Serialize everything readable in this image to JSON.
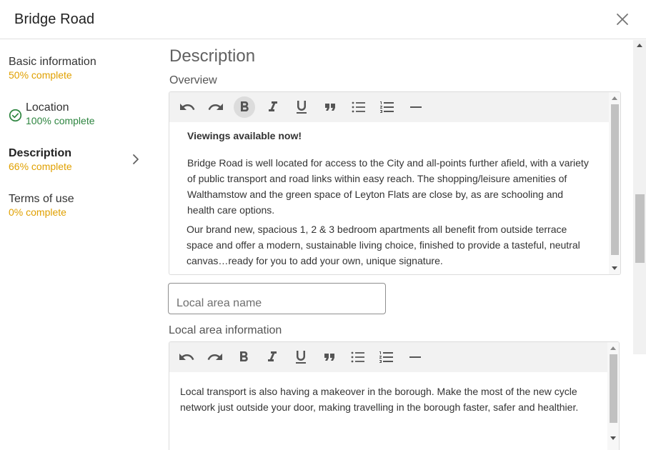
{
  "header": {
    "title": "Bridge Road",
    "close_icon": "close-icon"
  },
  "sidebar": {
    "items": [
      {
        "label": "Basic information",
        "status": "50% complete",
        "status_color": "#e0a000",
        "active": false
      },
      {
        "label": "Location",
        "status": "100% complete",
        "status_color": "#2e8540",
        "active": false,
        "icon": "check-circle-icon"
      },
      {
        "label": "Description",
        "status": "66% complete",
        "status_color": "#e0a000",
        "active": true,
        "icon": "chevron-right-icon"
      },
      {
        "label": "Terms of use",
        "status": "0% complete",
        "status_color": "#e0a000",
        "active": false
      }
    ]
  },
  "main": {
    "section_title": "Description",
    "overview": {
      "label": "Overview",
      "toolbar": [
        "undo-icon",
        "redo-icon",
        "bold-icon",
        "italic-icon",
        "underline-icon",
        "quote-icon",
        "bulleted-list-icon",
        "numbered-list-icon",
        "horizontal-rule-icon"
      ],
      "active_tool": "bold-icon",
      "paragraphs": [
        "Viewings available now!",
        "Bridge Road is well located for access to the City and all-points further afield, with a variety of public transport and road links within easy reach. The shopping/leisure amenities of Walthamstow and the green space of Leyton Flats are close by, as are schooling and health care options.",
        "Our brand new, spacious 1, 2 & 3 bedroom apartments all benefit from outside terrace space and offer a modern, sustainable living choice, finished to provide a tasteful, neutral canvas…ready for you to add your own, unique signature."
      ]
    },
    "local_area_name": {
      "value": "",
      "placeholder": "Local area name"
    },
    "local_area_info": {
      "label": "Local area information",
      "toolbar": [
        "undo-icon",
        "redo-icon",
        "bold-icon",
        "italic-icon",
        "underline-icon",
        "quote-icon",
        "bulleted-list-icon",
        "numbered-list-icon",
        "horizontal-rule-icon"
      ],
      "paragraphs": [
        "Local transport is also having a makeover in the borough. Make the most of the new cycle network just outside your door, making travelling in the borough faster, safer and healthier."
      ]
    }
  }
}
